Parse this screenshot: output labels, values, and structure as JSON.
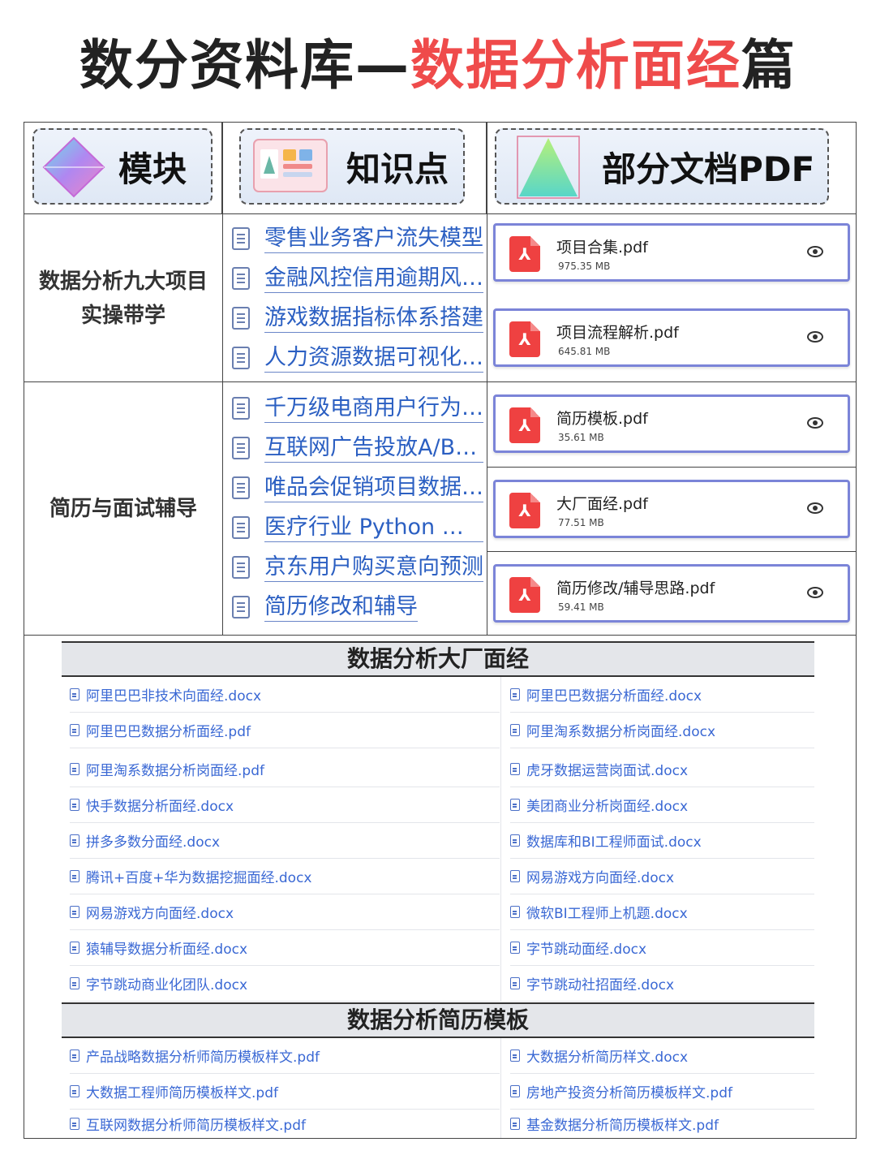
{
  "title": {
    "part1": "数分资料库—",
    "part2": "数据分析面经",
    "part3": "篇"
  },
  "header": {
    "col1": "模块",
    "col2": "知识点",
    "col3": "部分文档PDF",
    "col1_icon": "prism-icon",
    "col2_icon": "dashboard-icon",
    "col3_icon": "pyramid-icon"
  },
  "modules": [
    {
      "label_line1": "数据分析九大项目",
      "label_line2": "实操带学"
    },
    {
      "label": "简历与面试辅导"
    }
  ],
  "knowledge_points": [
    "零售业务客户流失模型",
    "金融风控信用逾期风险预测",
    "游戏数据指标体系搭建",
    "人力资源数据可视化分析",
    "千万级电商用户行为分析",
    "互联网广告投放A/B测试",
    "唯品会促销项目数据分析",
    "医疗行业 Python 数据分析",
    "京东用户购买意向预测",
    "简历修改和辅导"
  ],
  "pdfs": [
    {
      "name": "项目合集.pdf",
      "size": "975.35 MB"
    },
    {
      "name": "项目流程解析.pdf",
      "size": "645.81 MB"
    },
    {
      "name": "简历模板.pdf",
      "size": "35.61 MB"
    },
    {
      "name": "大厂面经.pdf",
      "size": "77.51 MB"
    },
    {
      "name": "简历修改/辅导思路.pdf",
      "size": "59.41 MB"
    }
  ],
  "section1": {
    "title": "数据分析大厂面经",
    "left": [
      "阿里巴巴非技术向面经.docx",
      "阿里巴巴数据分析面经.pdf",
      "阿里淘系数据分析岗面经.pdf",
      "快手数据分析面经.docx",
      "拼多多数分面经.docx",
      "腾讯+百度+华为数据挖掘面经.docx",
      "网易游戏方向面经.docx",
      "猿辅导数据分析面经.docx",
      "字节跳动商业化团队.docx"
    ],
    "right": [
      "阿里巴巴数据分析面经.docx",
      "阿里淘系数据分析岗面经.docx",
      "虎牙数据运营岗面试.docx",
      "美团商业分析岗面经.docx",
      "数据库和BI工程师面试.docx",
      "网易游戏方向面经.docx",
      "微软BI工程师上机题.docx",
      "字节跳动面经.docx",
      "字节跳动社招面经.docx"
    ]
  },
  "section2": {
    "title": "数据分析简历模板",
    "left": [
      "产品战略数据分析师简历模板样文.pdf",
      "大数据工程师简历模板样文.pdf",
      "互联网数据分析师简历模板样文.pdf"
    ],
    "right": [
      "大数据分析简历样文.docx",
      "房地产投资分析简历模板样文.pdf",
      "基金数据分析简历模板样文.pdf"
    ]
  }
}
